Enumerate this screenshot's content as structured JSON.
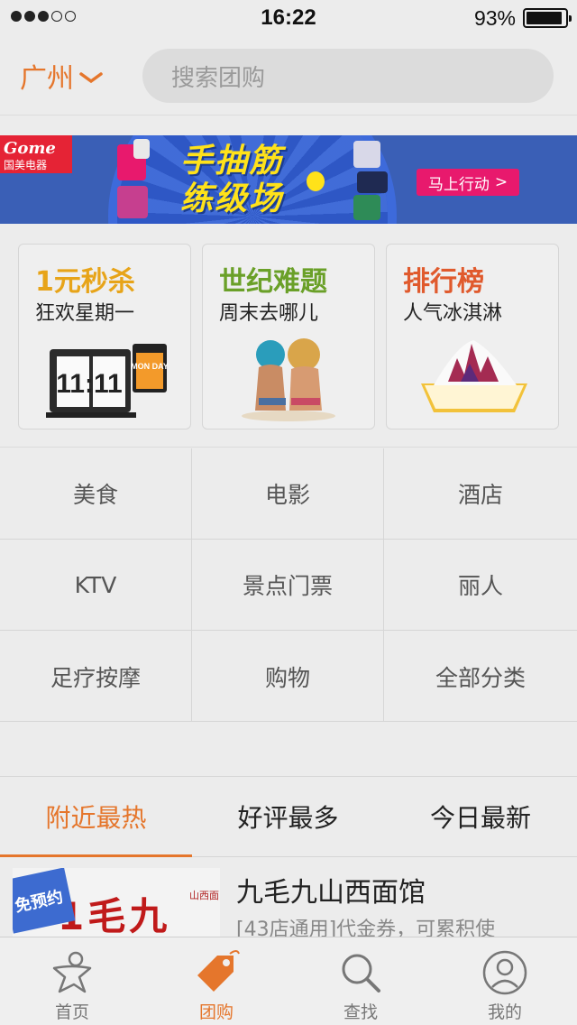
{
  "status_bar": {
    "signal_dots_filled": 3,
    "signal_dots_total": 5,
    "time": "16:22",
    "battery_percent_text": "93%",
    "battery_level": 0.93
  },
  "header": {
    "city": "广州",
    "search_placeholder": "搜索团购"
  },
  "banner": {
    "brand_name": "Gome",
    "brand_sub": "国美电器",
    "title_line1": "手抽筋",
    "title_line2": "练级场",
    "cta_label": "马上行动",
    "cta_arrow": ">"
  },
  "promos": [
    {
      "title": "1元秒杀",
      "subtitle": "狂欢星期一",
      "title_color": "#e7a419",
      "clock_text": "11:11",
      "clock_side": "MON DAY"
    },
    {
      "title": "世纪难题",
      "subtitle": "周末去哪儿",
      "title_color": "#6aa028"
    },
    {
      "title": "排行榜",
      "subtitle": "人气冰淇淋",
      "title_color": "#e05a2d"
    }
  ],
  "categories": [
    "美食",
    "电影",
    "酒店",
    "KTV",
    "景点门票",
    "丽人",
    "足疗按摩",
    "购物",
    "全部分类"
  ],
  "sort_tabs": [
    "附近最热",
    "好评最多",
    "今日最新"
  ],
  "deal": {
    "badge": "免预约",
    "logo_text": "1毛九",
    "logo_small": "山西面",
    "title": "九毛九山西面馆",
    "description": "[43店通用]代金券，可累积使"
  },
  "tabbar": [
    {
      "label": "首页",
      "icon": "home-person-icon"
    },
    {
      "label": "团购",
      "icon": "tag-icon"
    },
    {
      "label": "查找",
      "icon": "search-icon"
    },
    {
      "label": "我的",
      "icon": "user-icon"
    }
  ],
  "colors": {
    "accent": "#e5762c",
    "background": "#ececec",
    "banner_blue": "#3a5fb6",
    "cta_pink": "#e8196d"
  }
}
